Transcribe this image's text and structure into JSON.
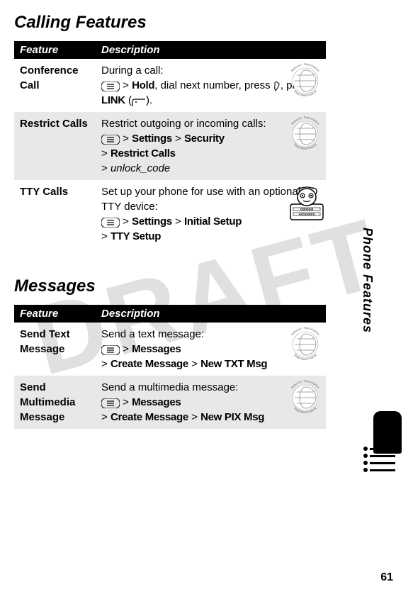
{
  "watermark": "DRAFT",
  "sections": {
    "calling": {
      "title": "Calling Features",
      "header_feature": "Feature",
      "header_desc": "Description",
      "rows": {
        "conference": {
          "name": "Conference Call",
          "text1": "During a call:",
          "hold": "Hold",
          "text2": ", dial next number, press ",
          "text3": ", press ",
          "link": "LINK",
          "text4": " ("
        },
        "restrict": {
          "name": "Restrict Calls",
          "text1": "Restrict outgoing or incoming calls:",
          "settings": "Settings",
          "security": "Security",
          "restrict_calls": "Restrict Calls",
          "unlock": "unlock_code"
        },
        "tty": {
          "name": "TTY Calls",
          "text1": "Set up your phone for use with an optional TTY device:",
          "settings": "Settings",
          "initial_setup": "Initial Setup",
          "tty_setup": "TTY Setup"
        }
      }
    },
    "messages": {
      "title": "Messages",
      "header_feature": "Feature",
      "header_desc": "Description",
      "rows": {
        "sendtext": {
          "name": "Send Text Message",
          "text1": "Send a text message:",
          "messages": "Messages",
          "create_message": "Create Message",
          "new_txt": "New TXT Msg"
        },
        "sendmms": {
          "name": "Send Multimedia Message",
          "text1": "Send a multimedia message:",
          "messages": "Messages",
          "create_message": "Create Message",
          "new_pix": "New PIX Msg"
        }
      }
    }
  },
  "side_label": "Phone Features",
  "page_number": "61",
  "icon_text": {
    "network_top": "Network / Subscription",
    "network_bottom": "Dependent  Feature",
    "optional": "Optional",
    "accessory": "Accessory"
  }
}
